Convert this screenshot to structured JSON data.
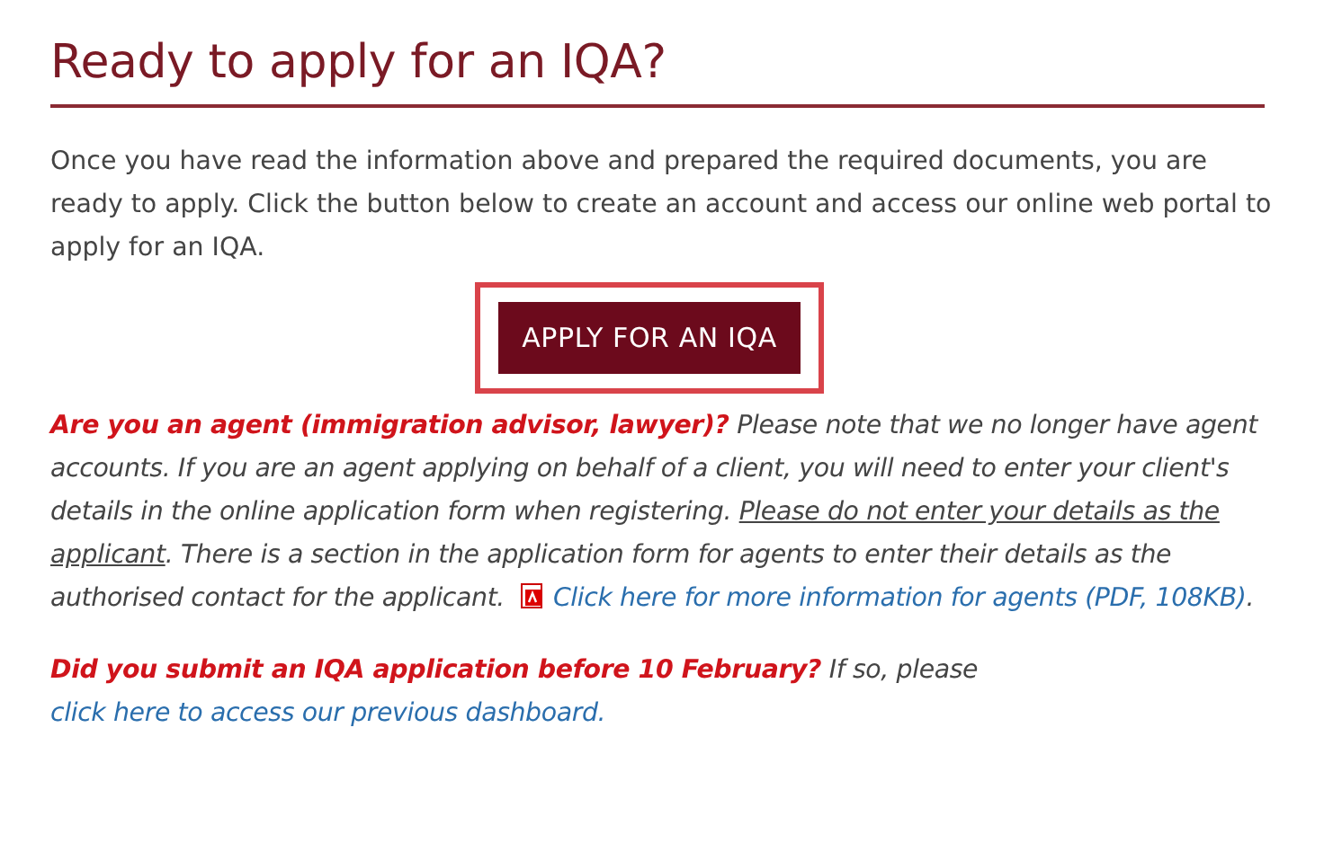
{
  "heading": "Ready to apply for an IQA?",
  "intro": "Once you have read the information above and prepared the required documents, you are ready to apply. Click the button below to create an account and access our online web portal to apply for an IQA.",
  "apply_button": {
    "label": "APPLY FOR AN IQA",
    "highlighted": true
  },
  "agent_note": {
    "segments": [
      {
        "text": "**Are you an agent (immigration advisor, lawyer)?** Please note that we no longer have agent accounts. If you are an agent applying on behalf of a client, you will need to enter your client's details in the online application form when registering. ",
        "underline": false
      },
      {
        "text": "Please do not enter your details as the applicant",
        "underline": true
      },
      {
        "text": ". There is a section in the application form for agents to enter their details as the authorised contact for the applicant.",
        "underline": false
      }
    ],
    "link": "Click here for more information for agents (PDF, 108KB)",
    "after_link": "."
  },
  "dashboard_note": {
    "text": "**Did you submit an IQA application before 10 February?** If so, please ",
    "link": "click here to access our previous dashboard."
  }
}
